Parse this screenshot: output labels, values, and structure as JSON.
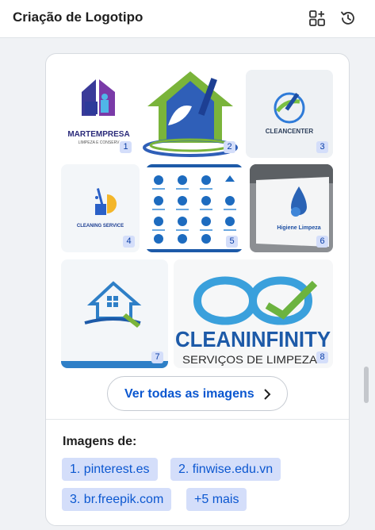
{
  "header": {
    "title": "Criação de Logotipo",
    "icons": [
      "new-chat-icon",
      "history-icon"
    ]
  },
  "gallery": {
    "images": [
      {
        "number": "1",
        "caption": "MARTEMPRESA",
        "subcaption": "LIMPEZA E CONSERV"
      },
      {
        "number": "2"
      },
      {
        "number": "3",
        "caption": "CLEANCENTER"
      },
      {
        "number": "4",
        "caption": "CLEANING SERVICE"
      },
      {
        "number": "5"
      },
      {
        "number": "6",
        "caption": "Higiene Limpeza"
      },
      {
        "number": "7"
      },
      {
        "number": "8",
        "caption": "CLEANINFINITY",
        "subcaption": "SERVIÇOS DE LIMPEZA"
      }
    ],
    "see_all_label": "Ver todas as imagens"
  },
  "sources": {
    "title": "Imagens de:",
    "items": [
      "1. pinterest.es",
      "2. finwise.edu.vn",
      "3. br.freepik.com",
      "+5 mais"
    ]
  },
  "colors": {
    "accent": "#0b57d0",
    "chip_bg": "#d4defa",
    "number_badge_text": "#0b3fa6"
  }
}
